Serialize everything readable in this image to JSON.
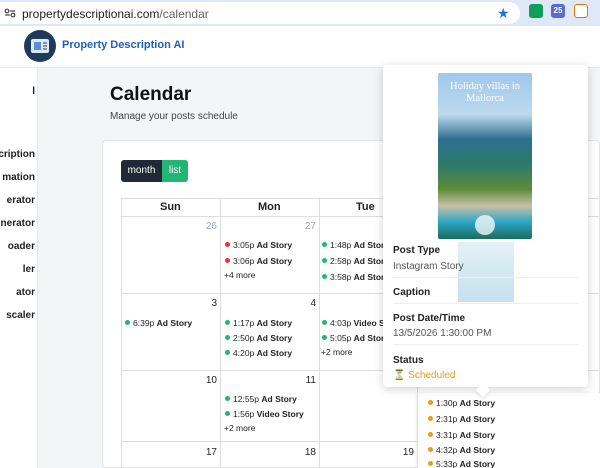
{
  "browser": {
    "domain": "propertydescriptionai.com",
    "path": "/calendar",
    "extensions": [
      "",
      "25",
      ""
    ]
  },
  "app": {
    "brand": "Property Description AI"
  },
  "sidebar": {
    "items": [
      "l",
      "scription",
      "mation",
      "erator",
      "nerator",
      "oader",
      "ler",
      "ator",
      "scaler"
    ]
  },
  "page": {
    "title": "Calendar",
    "subtitle": "Manage your posts schedule"
  },
  "view_buttons": {
    "month": "month",
    "list": "list"
  },
  "calendar": {
    "day_headers": [
      "Sun",
      "Mon",
      "Tue"
    ],
    "dates": {
      "sun1": "26",
      "mon1": "27",
      "sun2": "3",
      "mon2": "4",
      "sun3": "10",
      "mon3": "11",
      "sun4": "17",
      "mon4": "18",
      "tue4": "19"
    },
    "week1_mon": [
      {
        "time": "3:05p",
        "title": "Ad Story",
        "color": "#e53935"
      },
      {
        "time": "3:06p",
        "title": "Ad Story",
        "color": "#e53935"
      }
    ],
    "week1_mon_more": "+4 more",
    "week1_tue": [
      {
        "time": "1:48p",
        "title": "Ad Story",
        "color": "#22b573"
      },
      {
        "time": "2:58p",
        "title": "Ad Story",
        "color": "#22b573"
      },
      {
        "time": "3:58p",
        "title": "Ad Story",
        "color": "#22b573"
      }
    ],
    "week2_sun": [
      {
        "time": "6:39p",
        "title": "Ad Story",
        "color": "#22b573"
      }
    ],
    "week2_mon": [
      {
        "time": "1:17p",
        "title": "Ad Story",
        "color": "#22b573"
      },
      {
        "time": "2:50p",
        "title": "Ad Story",
        "color": "#22b573"
      },
      {
        "time": "4:20p",
        "title": "Ad Story",
        "color": "#22b573"
      }
    ],
    "week2_tue": [
      {
        "time": "4:03p",
        "title": "Video St",
        "color": "#22b573"
      },
      {
        "time": "5:05p",
        "title": "Ad Story",
        "color": "#22b573"
      }
    ],
    "week2_tue_more": "+2 more",
    "week3_mon": [
      {
        "time": "12:55p",
        "title": "Ad Story",
        "color": "#22b573"
      },
      {
        "time": "1:56p",
        "title": "Video Story",
        "color": "#22b573"
      }
    ],
    "week3_mon_more": "+2 more",
    "week3_wed": [
      {
        "time": "1:30p",
        "title": "Ad Story",
        "color": "#e89b1a"
      },
      {
        "time": "2:31p",
        "title": "Ad Story",
        "color": "#e89b1a"
      },
      {
        "time": "3:31p",
        "title": "Ad Story",
        "color": "#e89b1a"
      },
      {
        "time": "4:32p",
        "title": "Ad Story",
        "color": "#e89b1a"
      },
      {
        "time": "5:33p",
        "title": "Ad Story",
        "color": "#e89b1a"
      }
    ]
  },
  "popover": {
    "image_title": "Holiday villas in Mallorca",
    "post_type_label": "Post Type",
    "post_type_value": "Instagram Story",
    "caption_label": "Caption",
    "date_label": "Post Date/Time",
    "date_value": "13/5/2026 1:30:00 PM",
    "status_label": "Status",
    "status_icon": "hourglass-icon",
    "status_value": "Scheduled"
  }
}
